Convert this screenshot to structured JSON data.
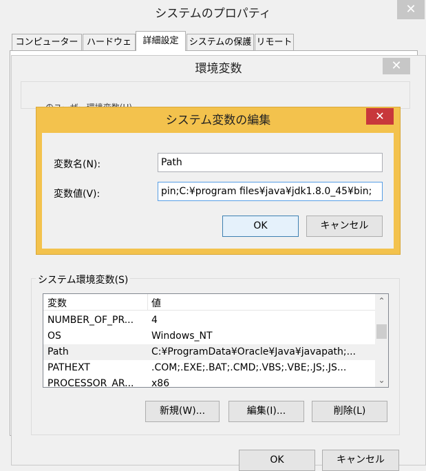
{
  "system_properties": {
    "title": "システムのプロパティ",
    "close_symbol": "✕",
    "tabs": [
      {
        "label": "コンピューター名"
      },
      {
        "label": "ハードウェア"
      },
      {
        "label": "詳細設定"
      },
      {
        "label": "システムの保護"
      },
      {
        "label": "リモート"
      }
    ],
    "active_tab": "詳細設定"
  },
  "env_dialog": {
    "title": "環境変数",
    "close_symbol": "✕",
    "user_group_label": "のユーザー環境変数(U)",
    "system_group_label": "システム環境変数(S)",
    "columns": {
      "variable": "変数",
      "value": "値"
    },
    "rows": [
      {
        "variable": "NUMBER_OF_PR...",
        "value": "4"
      },
      {
        "variable": "OS",
        "value": "Windows_NT"
      },
      {
        "variable": "Path",
        "value": "C:¥ProgramData¥Oracle¥Java¥javapath;..."
      },
      {
        "variable": "PATHEXT",
        "value": ".COM;.EXE;.BAT;.CMD;.VBS;.VBE;.JS;.JS..."
      },
      {
        "variable": "PROCESSOR_AR...",
        "value": "x86"
      }
    ],
    "selected_row": "Path",
    "scroll_up_symbol": "⌃",
    "scroll_down_symbol": "⌄",
    "buttons": {
      "new": "新規(W)...",
      "edit": "編集(I)...",
      "delete": "削除(L)"
    },
    "ok": "OK",
    "cancel": "キャンセル"
  },
  "edit_dialog": {
    "title": "システム変数の編集",
    "close_symbol": "✕",
    "name_label": "変数名(N):",
    "name_value": "Path",
    "value_label": "変数値(V):",
    "value_value": "pin;C:¥program files¥java¥jdk1.8.0_45¥bin;",
    "ok": "OK",
    "cancel": "キャンセル"
  },
  "colors": {
    "edit_title_bar": "#f3c24d",
    "close_active": "#c8373b",
    "close_inactive": "#c7c7c7",
    "focus_border": "#569de5"
  }
}
